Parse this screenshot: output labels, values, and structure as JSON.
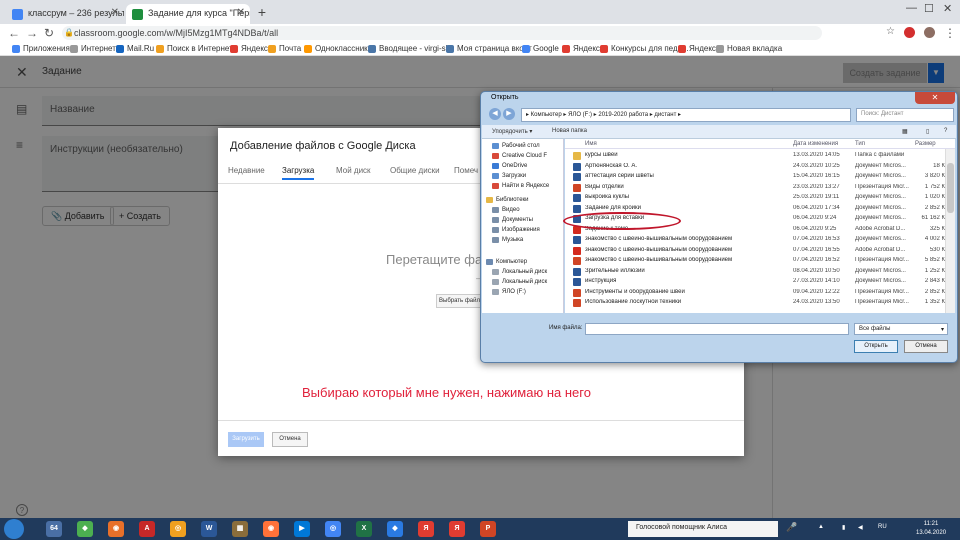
{
  "browser": {
    "tabs": [
      {
        "label": "классрум – 236 результатов. По"
      },
      {
        "label": "Задание для курса \"Первые вш"
      }
    ],
    "url": "classroom.google.com/w/MjI5Mzg1MTg4NDBa/t/all",
    "bookmarks": [
      "Приложения",
      "Интернет",
      "Mail.Ru",
      "Поиск в Интернете",
      "Яндекс",
      "Почта",
      "Одноклассники",
      "Вводящее - virgi-sb..",
      "Моя страница вконт",
      "Google",
      "Яндекс",
      "Конкурсы для педаг..",
      "Яндекс",
      "Новая вкладка"
    ]
  },
  "classroom": {
    "header_title": "Задание",
    "assign_button": "Создать задание",
    "title_placeholder": "Название",
    "instructions_placeholder": "Инструкции (необязательно)",
    "add_button": "Добавить",
    "create_button": "Создать"
  },
  "picker": {
    "title": "Добавление файлов с Google Диска",
    "tabs": [
      "Недавние",
      "Загрузка",
      "Мой диск",
      "Общие диски",
      "Помеч"
    ],
    "active_tab": "Загрузка",
    "drop_text": "Перетащите фа",
    "or_text": "– и",
    "select_button": "Выбрать файлы на",
    "caption": "Выбираю который мне нужен, нажимаю на него",
    "upload_button": "Загрузить",
    "cancel_button": "Отмена"
  },
  "file_dialog": {
    "title": "Открыть",
    "path": "▸ Компьютер ▸ ЯЛО (F:) ▸ 2019-2020 работа ▸ дистант ▸",
    "search_placeholder": "Поиск: Дистант",
    "organize": "Упорядочить ▾",
    "new_folder": "Новая папка",
    "nav_items": [
      {
        "label": "Рабочий стол",
        "color": "#5b8fd1"
      },
      {
        "label": "Creative Cloud F",
        "color": "#d84a3a"
      },
      {
        "label": "OneDrive",
        "color": "#3a7bd5"
      },
      {
        "label": "Загрузки",
        "color": "#5b8fd1"
      },
      {
        "label": "Найти в Яндексе",
        "color": "#d84a3a"
      },
      {
        "label": "Библиотеки",
        "color": "#e6b846"
      },
      {
        "label": "Видео",
        "color": "#7a8fa8"
      },
      {
        "label": "Документы",
        "color": "#7a8fa8"
      },
      {
        "label": "Изображения",
        "color": "#7a8fa8"
      },
      {
        "label": "Музыка",
        "color": "#7a8fa8"
      },
      {
        "label": "Компьютер",
        "color": "#6c8ab0"
      },
      {
        "label": "Локальный диск",
        "color": "#9aa5b2"
      },
      {
        "label": "Локальный диск",
        "color": "#9aa5b2"
      },
      {
        "label": "ЯЛО (F:)",
        "color": "#9aa5b2"
      }
    ],
    "columns": [
      "Имя",
      "Дата изменения",
      "Тип",
      "Размер"
    ],
    "rows": [
      {
        "name": "курсы швеи",
        "date": "13.03.2020 14:05",
        "type": "Папка с файлами",
        "size": "",
        "color": "#e6b846"
      },
      {
        "name": "Артюнянская О. А.",
        "date": "24.03.2020 10:25",
        "type": "Документ Micros...",
        "size": "18 К",
        "color": "#2b5797"
      },
      {
        "name": "аттестация серии шветы",
        "date": "15.04.2020 16:15",
        "type": "Документ Micros...",
        "size": "3 820 К",
        "color": "#2b5797"
      },
      {
        "name": "Виды отделки",
        "date": "23.03.2020 13:27",
        "type": "Презентация Micr...",
        "size": "1 752 К",
        "color": "#d04525"
      },
      {
        "name": "выкройка куклы",
        "date": "25.03.2020 19:11",
        "type": "Документ Micros...",
        "size": "1 020 К",
        "color": "#2b5797"
      },
      {
        "name": "Задание для кройки",
        "date": "06.04.2020 17:34",
        "type": "Документ Micros...",
        "size": "2 852 К",
        "color": "#2b5797"
      },
      {
        "name": "Загрузка для вставки",
        "date": "06.04.2020 9:24",
        "type": "Документ Micros...",
        "size": "61 162 К",
        "color": "#2b5797"
      },
      {
        "name": "Задание к теме",
        "date": "06.04.2020 9:25",
        "type": "Adobe Acrobat D...",
        "size": "325 К",
        "color": "#d42a1e"
      },
      {
        "name": "знакомство с швейно-вышивальным оборудованием",
        "date": "07.04.2020 16:53",
        "type": "Документ Micros...",
        "size": "4 002 К",
        "color": "#2b5797"
      },
      {
        "name": "знакомство с швейно-вышивальным оборудованием",
        "date": "07.04.2020 16:55",
        "type": "Adobe Acrobat D...",
        "size": "530 К",
        "color": "#d42a1e"
      },
      {
        "name": "знакомство с швейно-вышивальным оборудованием",
        "date": "07.04.2020 16:52",
        "type": "Презентация Micr...",
        "size": "5 852 К",
        "color": "#d04525"
      },
      {
        "name": "Зрительные иллюзии",
        "date": "08.04.2020 10:50",
        "type": "Документ Micros...",
        "size": "1 252 К",
        "color": "#2b5797"
      },
      {
        "name": "инструкция",
        "date": "27.03.2020 14:10",
        "type": "Документ Micros...",
        "size": "2 843 К",
        "color": "#2b5797"
      },
      {
        "name": "Инструменты и оборудование швеи",
        "date": "09.04.2020 12:22",
        "type": "Презентация Micr...",
        "size": "2 852 К",
        "color": "#d04525"
      },
      {
        "name": "Использование лоскутной техники",
        "date": "24.03.2020 13:50",
        "type": "Презентация Micr...",
        "size": "1 352 К",
        "color": "#d04525"
      }
    ],
    "filename_label": "Имя файла:",
    "filter": "Все файлы",
    "open_button": "Открыть",
    "cancel_button": "Отмена"
  },
  "taskbar": {
    "apps": [
      {
        "label": "64",
        "color": "#4a6fa5"
      },
      {
        "label": "◆",
        "color": "#4caf50"
      },
      {
        "label": "◉",
        "color": "#e8702a"
      },
      {
        "label": "A",
        "color": "#c62828"
      },
      {
        "label": "◎",
        "color": "#f0a020"
      },
      {
        "label": "W",
        "color": "#2b5797"
      },
      {
        "label": "▦",
        "color": "#8a6d3b"
      },
      {
        "label": "◉",
        "color": "#ff7139"
      },
      {
        "label": "▶",
        "color": "#0078d7"
      },
      {
        "label": "◎",
        "color": "#4285f4"
      },
      {
        "label": "X",
        "color": "#207245"
      },
      {
        "label": "◆",
        "color": "#2a7ae2"
      },
      {
        "label": "Я",
        "color": "#e03c31"
      },
      {
        "label": "Я",
        "color": "#e03c31"
      },
      {
        "label": "P",
        "color": "#d04525"
      }
    ],
    "assistant": "Голосовой помощник Алиса",
    "lang": "RU",
    "time": "11:21",
    "date": "13.04.2020"
  }
}
